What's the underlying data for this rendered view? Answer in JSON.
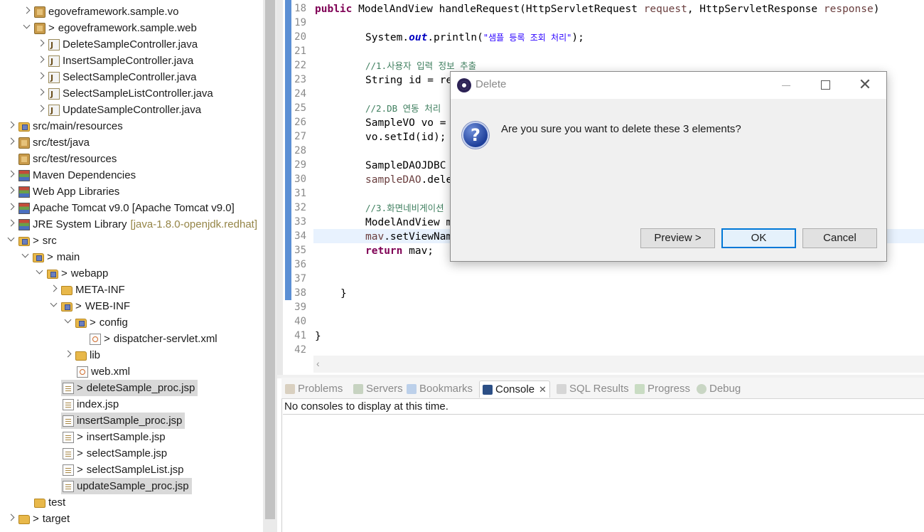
{
  "explorer": {
    "items": [
      {
        "label": "egoveframework.sample.vo",
        "prefix": "",
        "decor": ""
      },
      {
        "label": "egoveframework.sample.web",
        "prefix": ">",
        "decor": ""
      },
      {
        "label": "DeleteSampleController.java",
        "prefix": "",
        "decor": ""
      },
      {
        "label": "InsertSampleController.java",
        "prefix": "",
        "decor": ""
      },
      {
        "label": "SelectSampleController.java",
        "prefix": "",
        "decor": ""
      },
      {
        "label": "SelectSampleListController.java",
        "prefix": "",
        "decor": ""
      },
      {
        "label": "UpdateSampleController.java",
        "prefix": "",
        "decor": ""
      },
      {
        "label": "src/main/resources",
        "prefix": "",
        "decor": ""
      },
      {
        "label": "src/test/java",
        "prefix": "",
        "decor": ""
      },
      {
        "label": "src/test/resources",
        "prefix": "",
        "decor": ""
      },
      {
        "label": "Maven Dependencies",
        "prefix": "",
        "decor": ""
      },
      {
        "label": "Web App Libraries",
        "prefix": "",
        "decor": ""
      },
      {
        "label": "Apache Tomcat v9.0 [Apache Tomcat v9.0]",
        "prefix": "",
        "decor": ""
      },
      {
        "label": "JRE System Library",
        "prefix": "",
        "decor": "[java-1.8.0-openjdk.redhat]"
      },
      {
        "label": "src",
        "prefix": ">",
        "decor": ""
      },
      {
        "label": "main",
        "prefix": ">",
        "decor": ""
      },
      {
        "label": "webapp",
        "prefix": ">",
        "decor": ""
      },
      {
        "label": "META-INF",
        "prefix": "",
        "decor": ""
      },
      {
        "label": "WEB-INF",
        "prefix": ">",
        "decor": ""
      },
      {
        "label": "config",
        "prefix": ">",
        "decor": ""
      },
      {
        "label": "dispatcher-servlet.xml",
        "prefix": ">",
        "decor": ""
      },
      {
        "label": "lib",
        "prefix": "",
        "decor": ""
      },
      {
        "label": "web.xml",
        "prefix": "",
        "decor": ""
      },
      {
        "label": "deleteSample_proc.jsp",
        "prefix": ">",
        "decor": ""
      },
      {
        "label": "index.jsp",
        "prefix": "",
        "decor": ""
      },
      {
        "label": "insertSample_proc.jsp",
        "prefix": "",
        "decor": ""
      },
      {
        "label": "insertSample.jsp",
        "prefix": ">",
        "decor": ""
      },
      {
        "label": "selectSample.jsp",
        "prefix": ">",
        "decor": ""
      },
      {
        "label": "selectSampleList.jsp",
        "prefix": ">",
        "decor": ""
      },
      {
        "label": "updateSample_proc.jsp",
        "prefix": "",
        "decor": ""
      },
      {
        "label": "test",
        "prefix": "",
        "decor": ""
      },
      {
        "label": "target",
        "prefix": ">",
        "decor": ""
      }
    ]
  },
  "editor": {
    "line_numbers": [
      "18",
      "19",
      "20",
      "21",
      "22",
      "23",
      "24",
      "25",
      "26",
      "27",
      "28",
      "29",
      "30",
      "31",
      "32",
      "33",
      "34",
      "35",
      "36",
      "37",
      "38",
      "39",
      "40",
      "41",
      "42"
    ],
    "l18_kw": "public",
    "l18_a": " ModelAndView handleRequest(HttpServletRequest ",
    "l18_p1": "request",
    "l18_b": ", HttpServletResponse ",
    "l18_p2": "response",
    "l18_c": ")",
    "l20_a": "System.",
    "l20_fld": "out",
    "l20_b": ".println(",
    "l20_str": "\"샘플 등록 조회 처리\"",
    "l20_c": ");",
    "l22_cmt": "//1.사용자 입력 정보 추출",
    "l23": "String id = re",
    "l25_cmt": "//2.DB 연동 처리",
    "l26": "SampleVO vo =",
    "l27": "vo.setId(id);",
    "l29": "SampleDAOJDBC",
    "l30_a": "sampleDAO",
    "l30_b": ".dele",
    "l32_cmt": "//3.화면네비게이션",
    "l33": "ModelAndView m",
    "l34_a": "mav",
    "l34_b": ".setViewNam",
    "l35_kw": "return",
    "l35_b": " mav;",
    "l38": "}",
    "l41": "}"
  },
  "panel": {
    "tabs": [
      {
        "label": "Problems",
        "active": false
      },
      {
        "label": "Servers",
        "active": false
      },
      {
        "label": "Bookmarks",
        "active": false
      },
      {
        "label": "Console",
        "active": true
      },
      {
        "label": "SQL Results",
        "active": false
      },
      {
        "label": "Progress",
        "active": false
      },
      {
        "label": "Debug",
        "active": false
      }
    ],
    "close_glyph": "✕",
    "console_message": "No consoles to display at this time."
  },
  "dialog": {
    "title": "Delete",
    "message": "Are you sure you want to delete these 3 elements?",
    "question_glyph": "?",
    "close_glyph": "✕",
    "buttons": {
      "preview": "Preview >",
      "ok": "OK",
      "cancel": "Cancel"
    },
    "accent_color": "#0078d7"
  },
  "colors": {
    "keyword": "#7f0055",
    "string": "#2a00ff",
    "comment": "#3f7f5f",
    "field": "#0000c0"
  }
}
